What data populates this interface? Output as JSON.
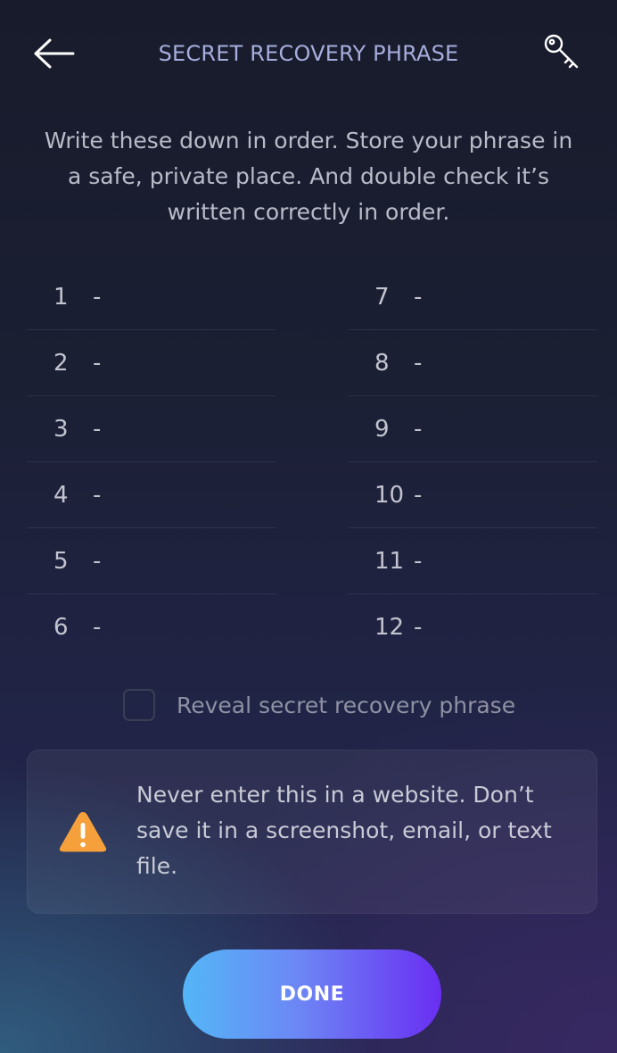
{
  "header": {
    "title": "SECRET RECOVERY PHRASE",
    "back_icon": "arrow-left-icon",
    "key_icon": "key-icon"
  },
  "instructions": "Write these down in order. Store your phrase in a safe, private place. And double check it’s written correctly in order.",
  "phrase": {
    "left": [
      {
        "index": "1",
        "sep": "-",
        "word": ""
      },
      {
        "index": "2",
        "sep": "-",
        "word": ""
      },
      {
        "index": "3",
        "sep": "-",
        "word": ""
      },
      {
        "index": "4",
        "sep": "-",
        "word": ""
      },
      {
        "index": "5",
        "sep": "-",
        "word": ""
      },
      {
        "index": "6",
        "sep": "-",
        "word": ""
      }
    ],
    "right": [
      {
        "index": "7",
        "sep": "-",
        "word": ""
      },
      {
        "index": "8",
        "sep": "-",
        "word": ""
      },
      {
        "index": "9",
        "sep": "-",
        "word": ""
      },
      {
        "index": "10",
        "sep": "-",
        "word": ""
      },
      {
        "index": "11",
        "sep": "-",
        "word": ""
      },
      {
        "index": "12",
        "sep": "-",
        "word": ""
      }
    ]
  },
  "reveal": {
    "label": "Reveal secret recovery phrase",
    "checked": false
  },
  "warning": {
    "icon": "warning-triangle-icon",
    "text": "Never enter this in a website. Don’t save it in a screenshot, email, or text file."
  },
  "done_button": {
    "label": "DONE"
  },
  "colors": {
    "title": "#a7addd",
    "warning_icon": "#f6a03c",
    "button_gradient_start": "#54b6f7",
    "button_gradient_end": "#6a2ef2"
  }
}
